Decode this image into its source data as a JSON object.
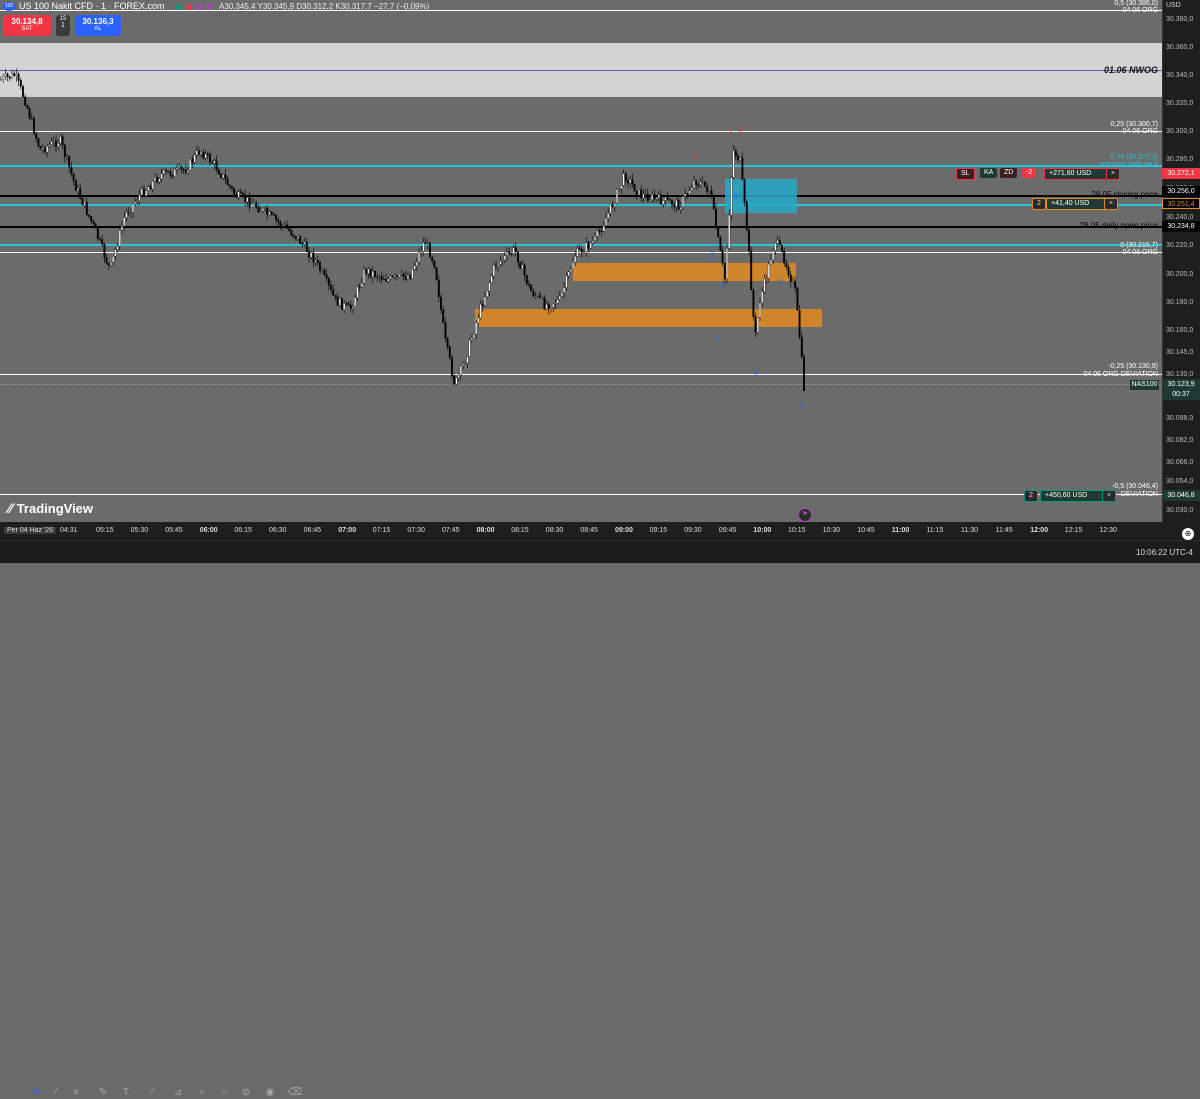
{
  "header": {
    "logo_badge": "100",
    "symbol_title": "US 100 Nakit CFD · 1 · FOREX.com",
    "ohlc": "A30.345,4 Y30.345,9 D30.312,2 K30.317,7 −27,7 (−0,09%)"
  },
  "trade": {
    "sell_price": "30.134,8",
    "sell_label": "SAT",
    "spread_top": "15",
    "spread_bottom": "1",
    "buy_price": "30.136,3",
    "buy_label": "AL"
  },
  "currency": "USD",
  "annotations": {
    "nwog": "01.06 NWOG",
    "fib_05": "0,5 (30.386,0)",
    "org_04_06_a": "04 06 ORG",
    "fib_025": "0,25 (30.300,7)",
    "org_04_06_b": "04 06 ORG",
    "fib_075": "0,75 (30.277,3)",
    "premium_daily": "premium daily wick",
    "closing_price": "28.05 closing price",
    "daily_open": "28.05 daily open price",
    "fib_0": "0 (30.215,7)",
    "org_04_06_c": "04 06 ORG",
    "fib_m025": "-0,25 (30.130,9)",
    "org_dev": "04 06 ORG DEVIATION",
    "fib_m05": "-0,5 (30.046,4)",
    "org_dev2": "DEVIATION"
  },
  "positions": {
    "p1_qty": "2",
    "p1_pnl": "+41,40 USD",
    "p2_pnl": "+271,60 USD",
    "p2_sl": "SL",
    "p2_ka": "KA",
    "p2_zd": "ZD",
    "p2_qty": "-2",
    "p3_qty": "2",
    "p3_pnl": "+450,60 USD",
    "close_x": "×"
  },
  "price_axis": {
    "ticks": [
      "30.380,0",
      "30.360,0",
      "30.340,0",
      "30.320,0",
      "30.300,0",
      "30.280,0",
      "30.260,0",
      "30.240,0",
      "30.220,0",
      "30.200,0",
      "30.180,0",
      "30.160,0",
      "30.145,0",
      "30.130,0",
      "30.114,0",
      "30.098,0",
      "30.082,0",
      "30.066,0",
      "30.054,0",
      "30.030,0"
    ],
    "tag_272": "30.272,1",
    "tag_256": "30.256,0",
    "tag_251": "30.251,4",
    "tag_234": "30.234,8",
    "tag_current": "30.123,9",
    "tag_timer": "00:37",
    "tag_symbol": "NAS100",
    "tag_046": "30.046,8"
  },
  "time_axis": {
    "start": "Per 04 Haz '26",
    "start_time": "04:31",
    "ticks": [
      "05:15",
      "05:30",
      "05:45",
      "06:00",
      "06:15",
      "06:30",
      "06:45",
      "07:00",
      "07:15",
      "07:30",
      "07:45",
      "08:00",
      "08:15",
      "08:30",
      "08:45",
      "09:00",
      "09:15",
      "09:30",
      "09:45",
      "10:00",
      "10:15",
      "10:30",
      "10:45",
      "11:00",
      "11:15",
      "11:30",
      "11:45",
      "12:00",
      "12:15",
      "12:30"
    ]
  },
  "watermark": "TradingView",
  "status_time": "10:06:22 UTC-4",
  "colors": {
    "bg": "#6b6b6b",
    "nwog_zone": "#d4d4d4",
    "orange_zone": "#e08a1e",
    "cyan_zone": "#26a8c8",
    "cyan_line": "#26c6da",
    "sell": "#f23645",
    "buy": "#2962ff"
  },
  "icons": [
    "crosshair-icon",
    "trendline-icon",
    "fib-icon",
    "brush-icon",
    "text-icon",
    "pattern-icon",
    "ruler-icon",
    "zoom-icon",
    "magnet-icon",
    "lock-icon",
    "eye-icon",
    "trash-icon"
  ]
}
